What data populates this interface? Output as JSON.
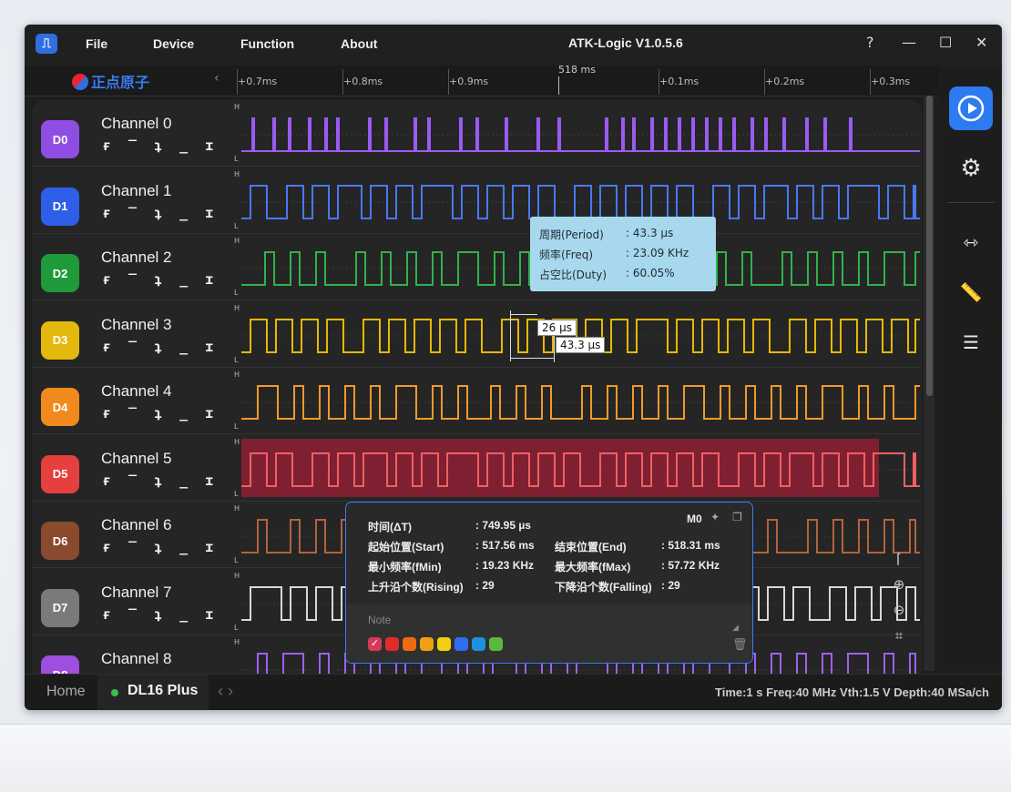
{
  "app": {
    "title": "ATK-Logic  V1.0.5.6",
    "logo_glyph": "⎍",
    "menu": [
      "File",
      "Device",
      "Function",
      "About"
    ],
    "window_controls": [
      "?",
      "—",
      "☐",
      "✕"
    ]
  },
  "ruler": {
    "brand": "正点原子",
    "cursor_label": "518 ms",
    "ticks": [
      "+0.7ms",
      "+0.8ms",
      "+0.9ms",
      "+0.1ms",
      "+0.2ms",
      "+0.3ms"
    ],
    "collapse": "‹"
  },
  "channels": [
    {
      "badge": "D0",
      "name": "Channel 0",
      "color": "#8f4ee3",
      "wave": "#9a5cf0"
    },
    {
      "badge": "D1",
      "name": "Channel 1",
      "color": "#2f5fe8",
      "wave": "#4a78f5"
    },
    {
      "badge": "D2",
      "name": "Channel 2",
      "color": "#1f9a3a",
      "wave": "#2fb34a"
    },
    {
      "badge": "D3",
      "name": "Channel 3",
      "color": "#e2b90c",
      "wave": "#e8b800"
    },
    {
      "badge": "D4",
      "name": "Channel 4",
      "color": "#f08a1d",
      "wave": "#f09a2a"
    },
    {
      "badge": "D5",
      "name": "Channel 5",
      "color": "#e5403d",
      "wave": "#f06060"
    },
    {
      "badge": "D6",
      "name": "Channel 6",
      "color": "#8a4a2d",
      "wave": "#b0643c"
    },
    {
      "badge": "D7",
      "name": "Channel 7",
      "color": "#7a7a7a",
      "wave": "#d8d8d8"
    },
    {
      "badge": "D8",
      "name": "Channel 8",
      "color": "#a04ee0",
      "wave": "#a060f0"
    }
  ],
  "trigger_glyphs": "ғ ‾ ʇ _ ɪ",
  "level_high": "H",
  "level_low": "L",
  "period_tip": {
    "rows": [
      {
        "k": "周期(Period)",
        "v": ": 43.3 µs"
      },
      {
        "k": "频率(Freq)",
        "v": ": 23.09 KHz"
      },
      {
        "k": "占空比(Duty)",
        "v": ": 60.05%"
      }
    ]
  },
  "measures": {
    "pulse": "26 µs",
    "period": "43.3 µs"
  },
  "popup": {
    "marker": "M0",
    "rows": [
      {
        "k1": "时间(ΔT)",
        "v1": ": 749.95 µs",
        "k2": "",
        "v2": ""
      },
      {
        "k1": "起始位置(Start)",
        "v1": ": 517.56 ms",
        "k2": "结束位置(End)",
        "v2": ": 518.31 ms"
      },
      {
        "k1": "最小频率(fMin)",
        "v1": ": 19.23 KHz",
        "k2": "最大频率(fMax)",
        "v2": ": 57.72 KHz"
      },
      {
        "k1": "上升沿个数(Rising)",
        "v1": ": 29",
        "k2": "下降沿个数(Falling)",
        "v2": ": 29"
      }
    ],
    "note_placeholder": "Note",
    "colors": [
      "#e8e8e8",
      "#e02b2b",
      "#f06a10",
      "#f0a010",
      "#f0d010",
      "#2f6ef0",
      "#1e90e0",
      "#5ab83c"
    ]
  },
  "status": {
    "home": "Home",
    "device": "DL16 Plus",
    "nav": "‹  ›",
    "text": "Time:1 s   Freq:40 MHz   Vth:1.5 V   Depth:40 MSa/ch"
  }
}
